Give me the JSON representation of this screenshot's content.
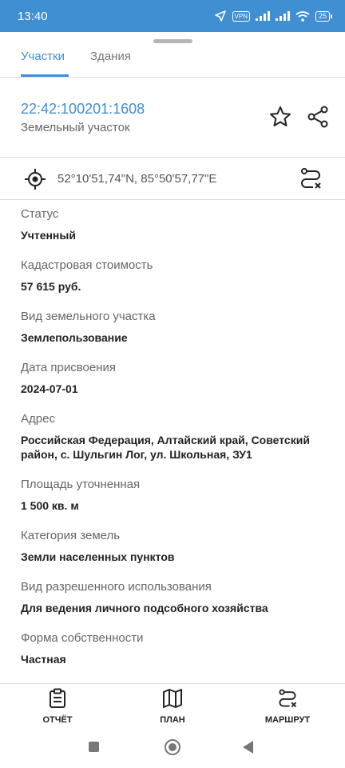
{
  "status_bar": {
    "time": "13:40",
    "vpn": "VPN",
    "battery": "25"
  },
  "tabs": [
    {
      "label": "Участки",
      "active": true
    },
    {
      "label": "Здания",
      "active": false
    }
  ],
  "object": {
    "cadastral_number": "22:42:100201:1608",
    "type": "Земельный участок"
  },
  "coordinates": "52°10'51,74\"N, 85°50'57,77\"E",
  "fields": [
    {
      "label": "Статус",
      "value": "Учтенный"
    },
    {
      "label": "Кадастровая стоимость",
      "value": "57 615 руб."
    },
    {
      "label": "Вид земельного участка",
      "value": "Землепользование"
    },
    {
      "label": "Дата присвоения",
      "value": "2024-07-01"
    },
    {
      "label": "Адрес",
      "value": "Российская Федерация, Алтайский край, Советский район, с. Шульгин Лог, ул. Школьная, ЗУ1"
    },
    {
      "label": "Площадь уточненная",
      "value": "1 500 кв. м"
    },
    {
      "label": "Категория земель",
      "value": "Земли населенных пунктов"
    },
    {
      "label": "Вид разрешенного использования",
      "value": "Для ведения личного подсобного хозяйства"
    },
    {
      "label": "Форма собственности",
      "value": "Частная"
    }
  ],
  "bottom_nav": {
    "report": "ОТЧЁТ",
    "plan": "ПЛАН",
    "route": "МАРШРУТ"
  },
  "colors": {
    "accent": "#3f8fd2",
    "status_bar": "#3f8fd2"
  }
}
